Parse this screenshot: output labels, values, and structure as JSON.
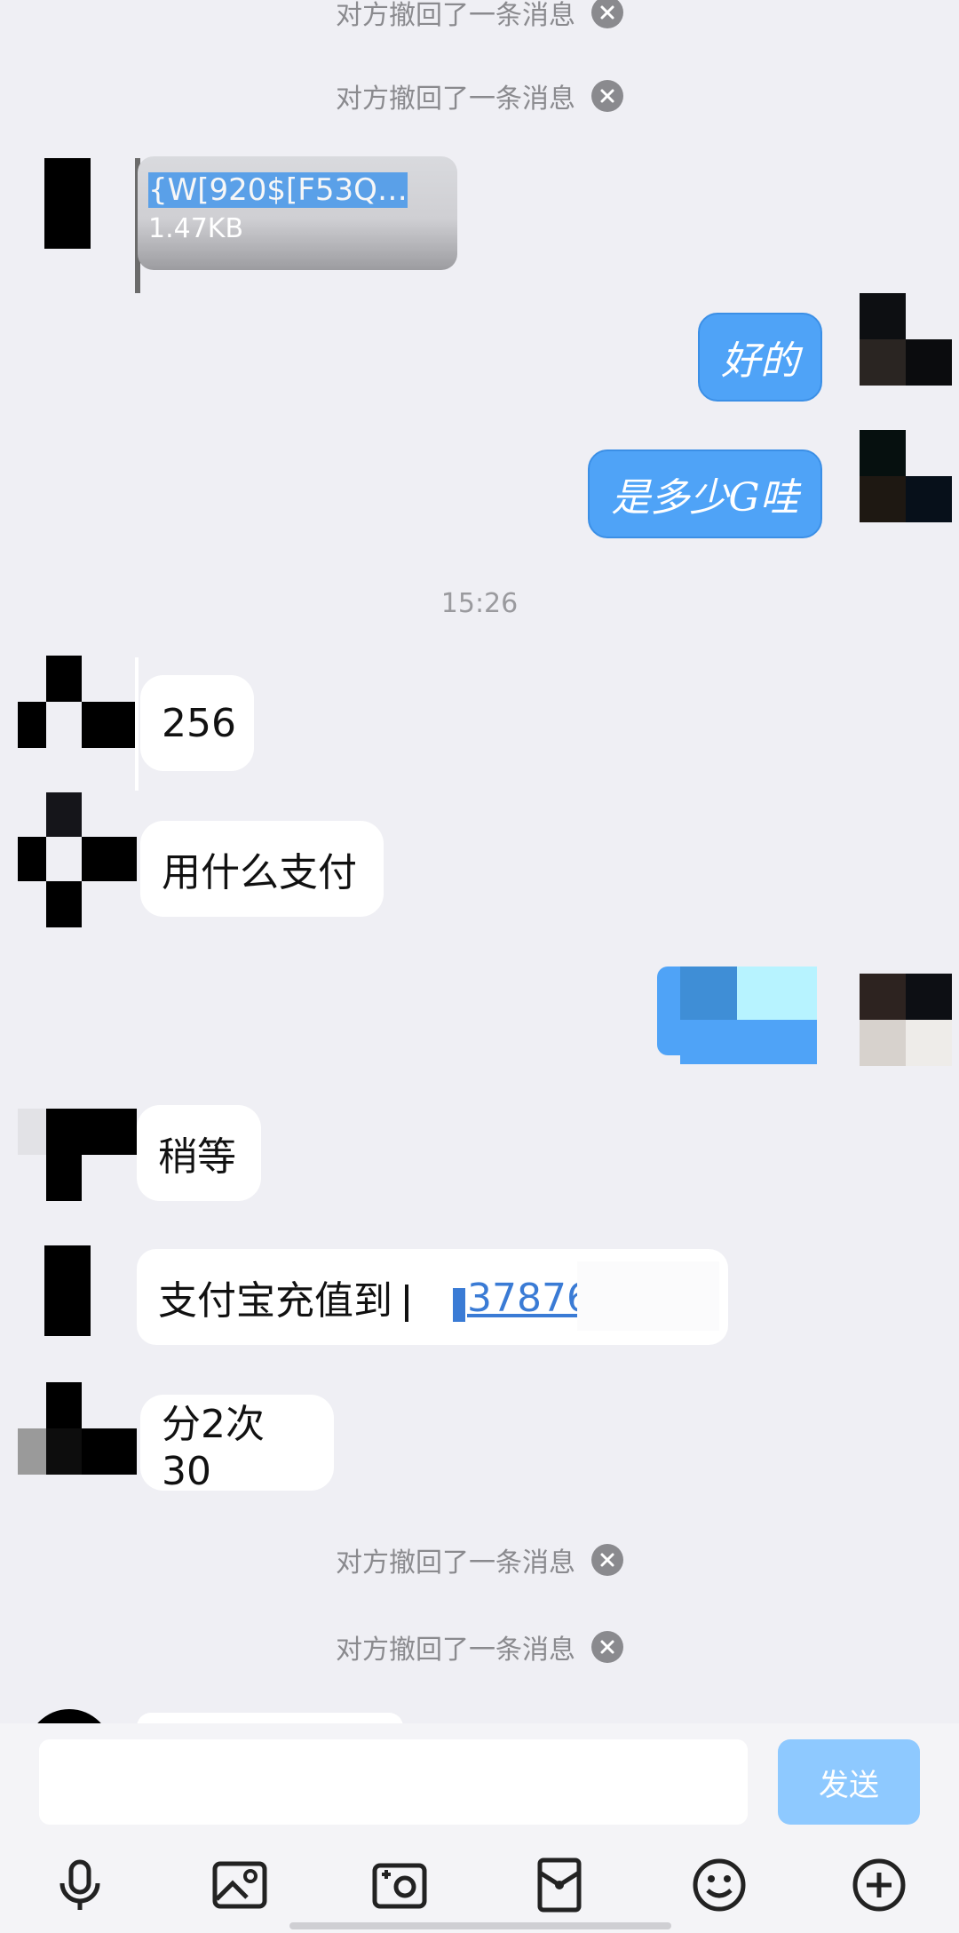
{
  "notices": {
    "recalled_1": "对方撤回了一条消息",
    "recalled_2": "对方撤回了一条消息",
    "recalled_3": "对方撤回了一条消息",
    "recalled_4": "对方撤回了一条消息"
  },
  "file_message": {
    "name": "{W[920$[F53Q…",
    "size": "1.47KB"
  },
  "messages_out": [
    {
      "text": "好的"
    },
    {
      "text": "是多少G哇"
    }
  ],
  "timestamp": "15:26",
  "messages_in": [
    {
      "text": "256"
    },
    {
      "text": "用什么支付"
    },
    {
      "text": "稍等"
    },
    {
      "text": "支付宝充值到",
      "link": "37876"
    },
    {
      "text": "分2次30"
    }
  ],
  "composer": {
    "send_label": "发送"
  },
  "toolbar": {
    "icons": [
      "microphone-icon",
      "image-icon",
      "camera-icon",
      "red-packet-icon",
      "emoji-icon",
      "plus-icon"
    ]
  },
  "colors": {
    "background": "#efeff4",
    "outgoing_bubble": "#4fa3f7",
    "send_button": "#8ec9ff",
    "link": "#3a7bd5",
    "notice_text": "#8a8a8e"
  }
}
